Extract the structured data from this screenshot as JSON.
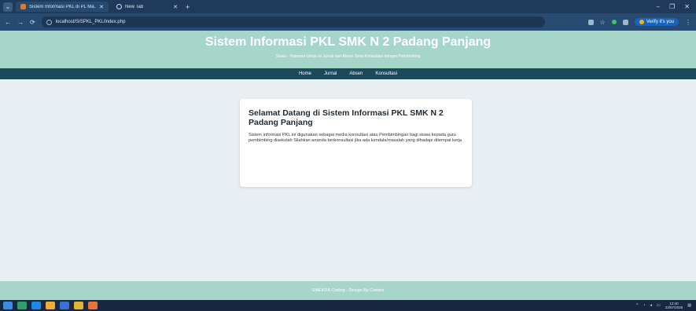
{
  "browser": {
    "tabs": [
      {
        "title": "Sistem Informasi PKL di PL Ma...",
        "active": true
      },
      {
        "title": "New Tab",
        "active": false
      }
    ],
    "url": "localhost/SISPKL_PKL/index.php",
    "verify_label": "Verify it's you",
    "window_controls": [
      "–",
      "❐",
      "✕"
    ]
  },
  "site": {
    "title": "Sistem Informasi PKL SMK N 2 Padang Panjang",
    "subtitle": "Siswa - Halaman Untuk Isi Jurnal dan Absen Serta Konsultasi dengan Pembimbing",
    "nav": [
      "Home",
      "Jurnal",
      "Absen",
      "Konsultasi"
    ],
    "card": {
      "title": "Selamat Datang di Sistem Informasi PKL SMK N 2 Padang Panjang",
      "text": "Sistem informasi PKL ini digunakan sebagai media konsultasi atau Pembimbingan bagi siswa kepada guru pembimbing disekolah Silahkan ananda berkonsultasi jika ada kendala/masalah yang dihadapi ditempat kerja"
    },
    "footer": "SMEKDA Coding - Design By Candra"
  },
  "taskbar": {
    "time": "12:40",
    "date": "23/07/2025"
  },
  "colors": {
    "header_bg": "#a6d5c9",
    "nav_bg": "#1c4a5c",
    "page_bg": "#e9eef2"
  }
}
